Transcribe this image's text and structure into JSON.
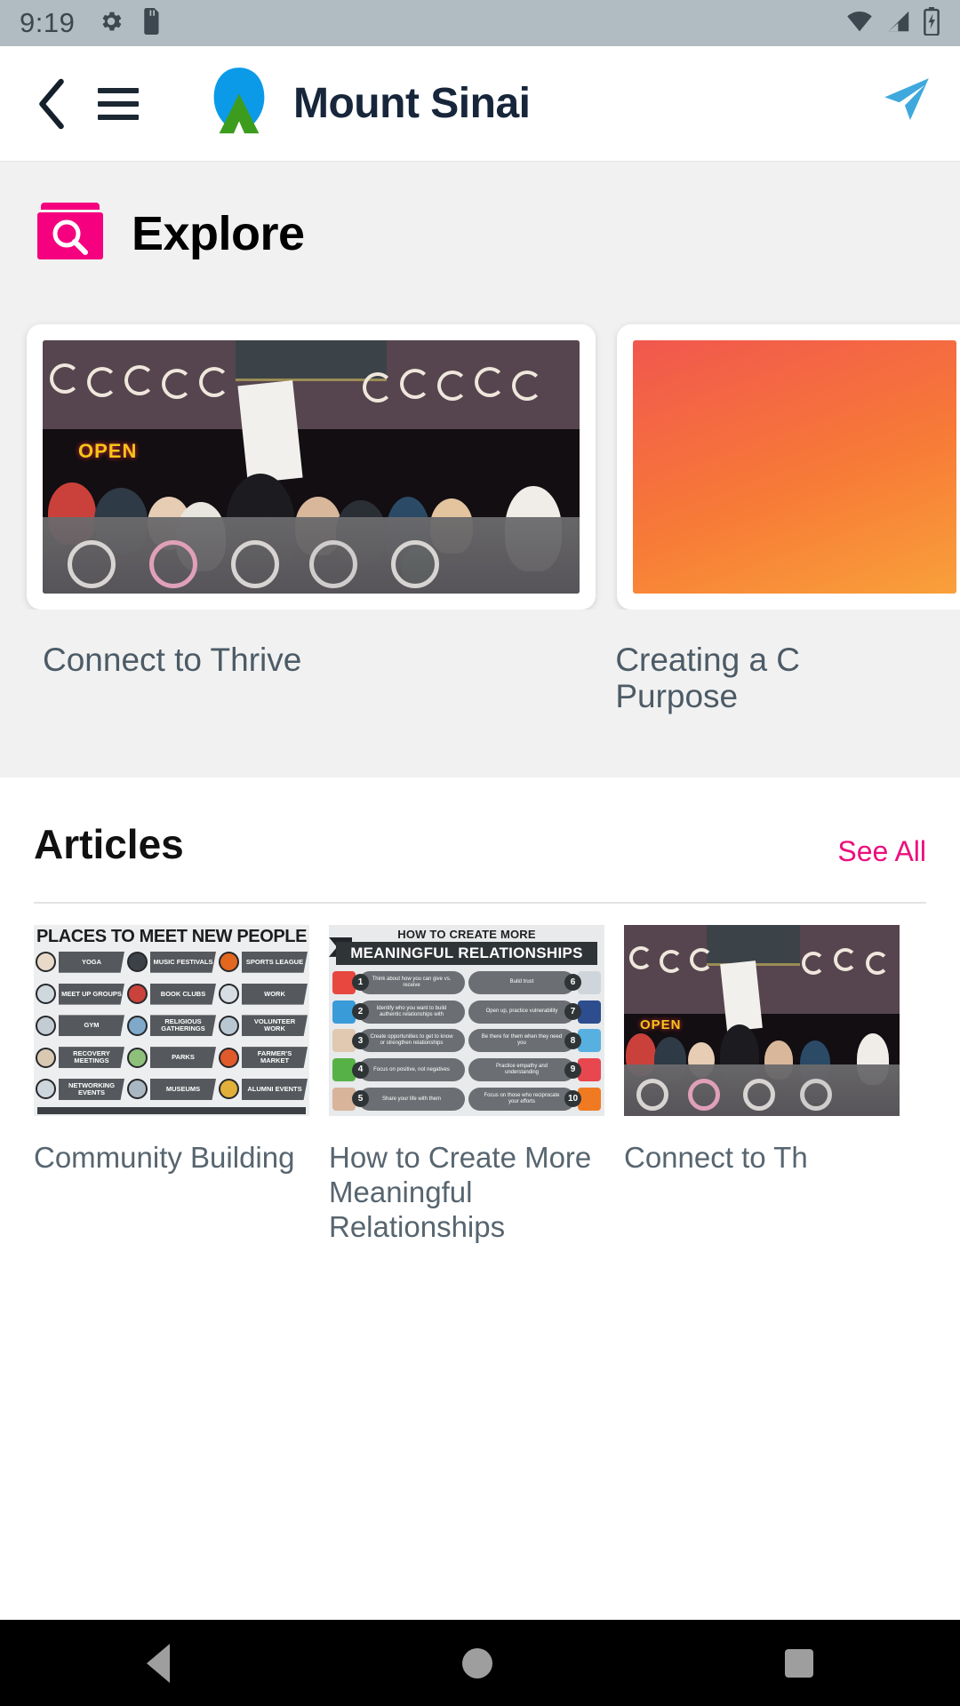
{
  "status_bar": {
    "time": "9:19",
    "icons": [
      "settings-gear-icon",
      "sd-card-icon"
    ],
    "right_icons": [
      "wifi-icon",
      "cell-signal-icon",
      "battery-charging-icon"
    ],
    "background": "#b0bcc2"
  },
  "header": {
    "back_icon": "chevron-left-icon",
    "menu_icon": "hamburger-menu-icon",
    "brand_name": "Mount Sinai",
    "logo_icon": "mount-sinai-logo-icon",
    "logo_blue": "#0b9ae8",
    "logo_green": "#3d9c1e",
    "send_icon": "paper-plane-send-icon",
    "send_color": "#3fa9dd"
  },
  "explore": {
    "title": "Explore",
    "icon": "explore-search-folder-icon",
    "icon_color": "#f5007e",
    "cards": [
      {
        "title": "Connect to Thrive",
        "image": "crowd-hugging-outside-storefront-photo"
      },
      {
        "title": "Creating a C\nPurpose",
        "image": "orange-gradient-placeholder"
      }
    ]
  },
  "articles": {
    "heading": "Articles",
    "see_all_label": "See All",
    "see_all_color": "#ec0f7c",
    "items": [
      {
        "title": "Community Building",
        "thumb": "places-to-meet-new-people-infographic",
        "infographic": {
          "title": "PLACES TO MEET NEW PEOPLE",
          "cells": [
            "YOGA",
            "MUSIC FESTIVALS",
            "SPORTS LEAGUE",
            "MEET UP GROUPS",
            "BOOK CLUBS",
            "WORK",
            "GYM",
            "RELIGIOUS GATHERINGS",
            "VOLUNTEER WORK",
            "RECOVERY MEETINGS",
            "PARKS",
            "FARMER'S MARKET",
            "NETWORKING EVENTS",
            "MUSEUMS",
            "ALUMNI EVENTS"
          ],
          "icon_colors": [
            "#e8d9c8",
            "#3c4148",
            "#e2671f",
            "#cfd8dd",
            "#c9423c",
            "#d7dde2",
            "#c3ccd3",
            "#7fa8c9",
            "#b9c7d2",
            "#d9c9b2",
            "#8ec07c",
            "#e05a2b",
            "#cdd6dc",
            "#a9b7c2",
            "#e0b03a"
          ]
        }
      },
      {
        "title": "How to Create More Meaningful Relationships",
        "thumb": "meaningful-relationships-infographic",
        "infographic": {
          "title_top": "HOW TO CREATE MORE",
          "title_band": "MEANINGFUL RELATIONSHIPS",
          "steps": [
            {
              "n": "1",
              "text": "Think about how you can give vs. receive"
            },
            {
              "n": "6",
              "text": "Build trust"
            },
            {
              "n": "2",
              "text": "Identify who you want to build authentic relationships with"
            },
            {
              "n": "7",
              "text": "Open up, practice vulnerability"
            },
            {
              "n": "3",
              "text": "Create opportunities to get to know or strengthen relationships"
            },
            {
              "n": "8",
              "text": "Be there for them when they need you"
            },
            {
              "n": "4",
              "text": "Focus on positive, not negatives"
            },
            {
              "n": "9",
              "text": "Practice empathy and understanding"
            },
            {
              "n": "5",
              "text": "Share your life with them"
            },
            {
              "n": "10",
              "text": "Focus on those who reciprocate your efforts"
            }
          ],
          "icon_colors": [
            "#e8473f",
            "#cfd6db",
            "#3a9bd9",
            "#2d4d8e",
            "#e0c9b0",
            "#58b0e0",
            "#56b247",
            "#e8474f",
            "#d7b49a",
            "#f07a22"
          ]
        }
      },
      {
        "title": "Connect to Th",
        "thumb": "crowd-hugging-outside-storefront-photo"
      }
    ]
  },
  "nav_bar": {
    "back": "nav-back-triangle-icon",
    "home": "nav-home-circle-icon",
    "recents": "nav-recents-square-icon"
  }
}
